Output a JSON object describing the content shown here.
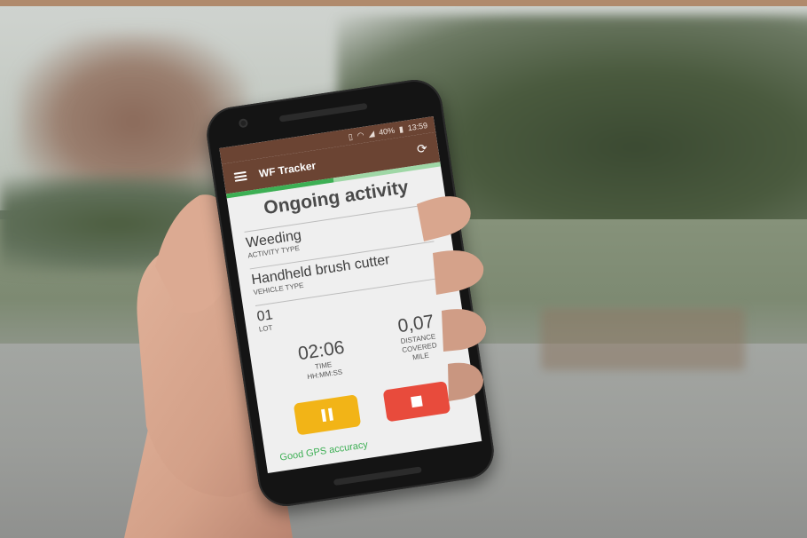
{
  "statusbar": {
    "icons": [
      "vibrate-icon",
      "wifi-icon",
      "signal-icon",
      "battery-icon"
    ],
    "battery": "40%",
    "time": "13:59"
  },
  "appbar": {
    "title": "WF Tracker",
    "menu_icon": "hamburger-menu-icon",
    "sync_icon": "sync-icon"
  },
  "progress": {
    "fraction": 0.5
  },
  "activity": {
    "heading": "Ongoing activity",
    "fields": [
      {
        "value": "Weeding",
        "label": "ACTIVITY TYPE"
      },
      {
        "value": "Handheld brush cutter",
        "label": "VEHICLE TYPE"
      },
      {
        "value": "01",
        "label": "LOT"
      }
    ],
    "time": {
      "value": "02:06",
      "label": "TIME",
      "unit": "HH:MM:SS"
    },
    "distance": {
      "value": "0,07",
      "label_line1": "DISTANCE",
      "label_line2": "COVERED",
      "unit": "MILE"
    },
    "gps_status": "Good GPS accuracy"
  },
  "colors": {
    "brand": "#6b4433",
    "accent_green": "#3daf54",
    "pause_yellow": "#f2b417",
    "stop_red": "#e84b3c"
  }
}
